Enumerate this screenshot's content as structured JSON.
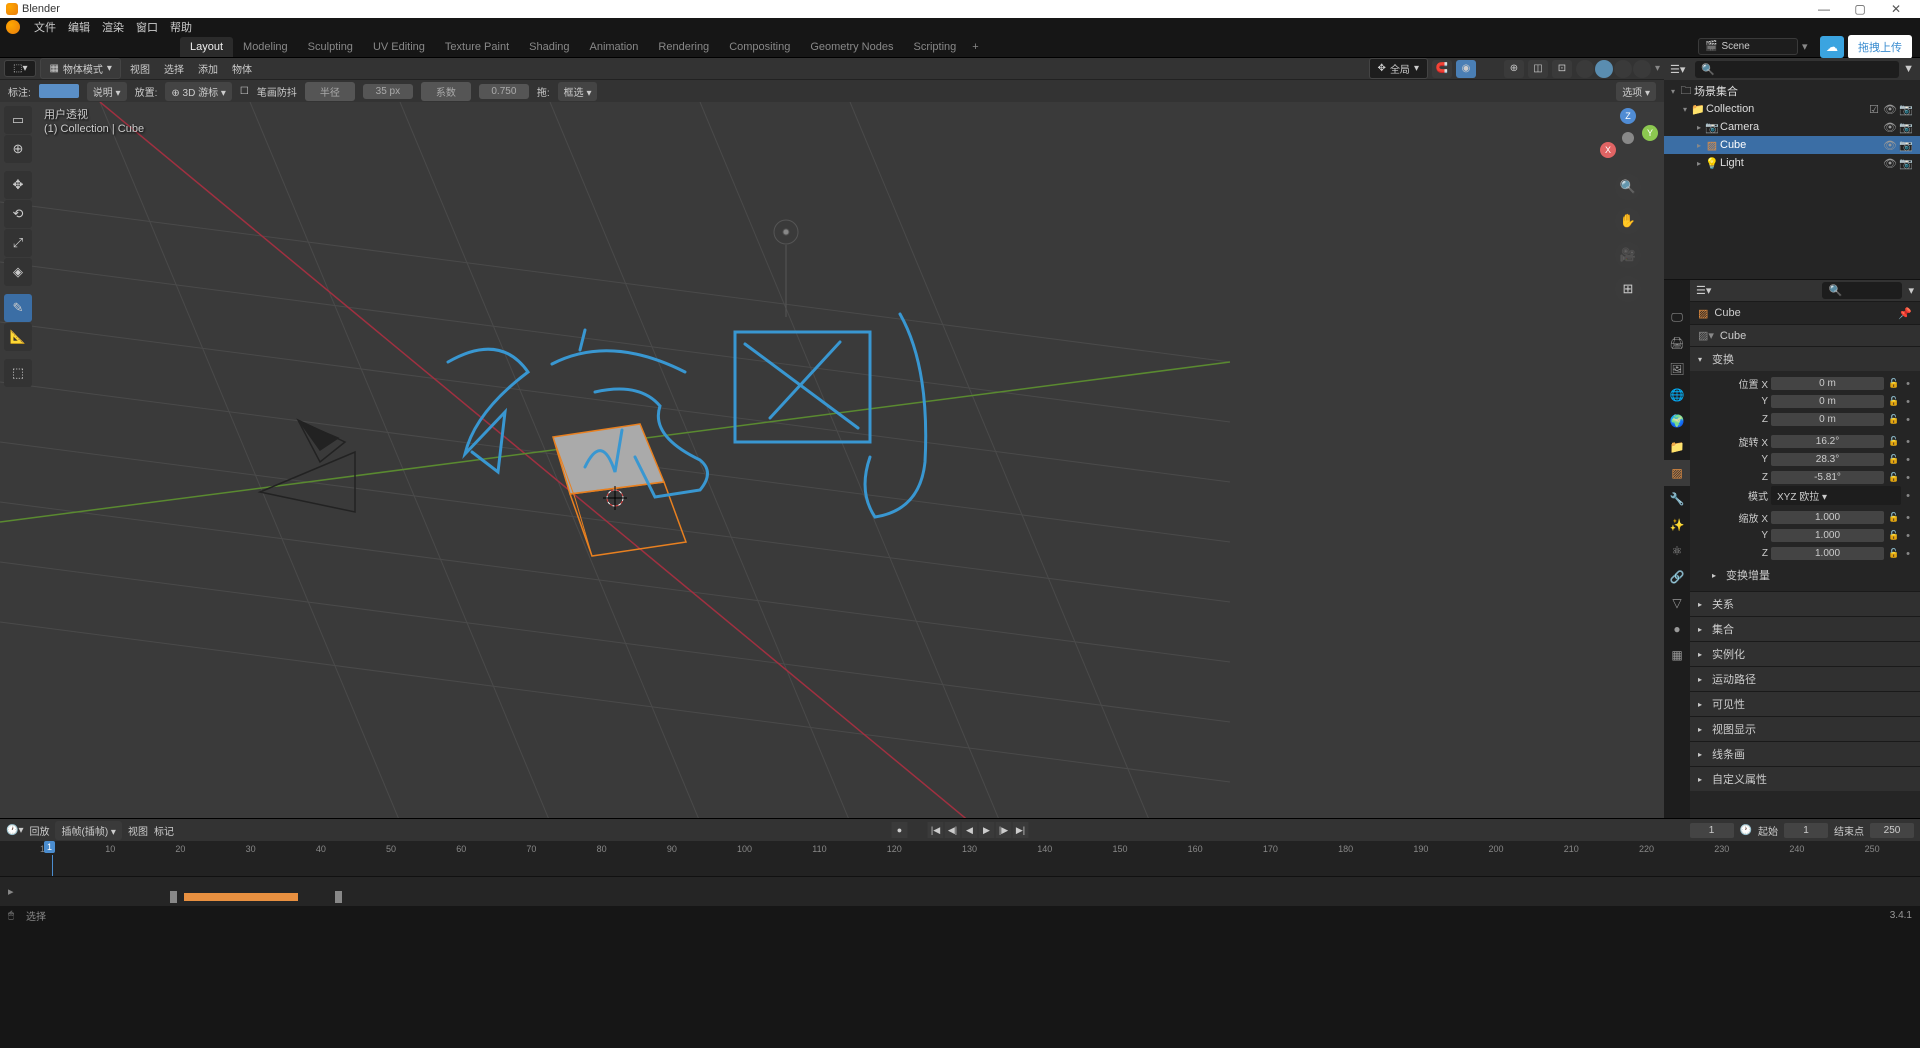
{
  "app_title": "Blender",
  "top_menu": [
    "文件",
    "编辑",
    "渲染",
    "窗口",
    "帮助"
  ],
  "workspaces": {
    "tabs": [
      "Layout",
      "Modeling",
      "Sculpting",
      "UV Editing",
      "Texture Paint",
      "Shading",
      "Animation",
      "Rendering",
      "Compositing",
      "Geometry Nodes",
      "Scripting"
    ],
    "active": 0
  },
  "scene_field": "Scene",
  "upload_button": "拖拽上传",
  "viewport_header": {
    "mode": "物体模式",
    "menus": [
      "视图",
      "选择",
      "添加",
      "物体"
    ],
    "global": "全局",
    "options": "选项"
  },
  "annotate_bar": {
    "label": "标注:",
    "note": "说明",
    "placement": "放置:",
    "cursor3d": "3D 游标",
    "stabilize": "笔画防抖",
    "radius_label": "半径",
    "radius_value": "35 px",
    "coeff_label": "系数",
    "coeff_value": "0.750",
    "drag": "拖:",
    "box_select": "框选"
  },
  "viewport_overlay": {
    "line1": "用户透视",
    "line2": "(1) Collection | Cube"
  },
  "outliner": {
    "root": "场景集合",
    "items": [
      {
        "name": "Collection",
        "icon": "📁",
        "children": [
          {
            "name": "Camera",
            "icon": "📷"
          },
          {
            "name": "Cube",
            "icon": "▨",
            "selected": true
          },
          {
            "name": "Light",
            "icon": "💡"
          }
        ]
      }
    ]
  },
  "properties": {
    "breadcrumb": "Cube",
    "data_name": "Cube",
    "panels": {
      "transform": {
        "title": "变换",
        "location_label": "位置",
        "location": {
          "X": "0 m",
          "Y": "0 m",
          "Z": "0 m"
        },
        "rotation_label": "旋转",
        "rotation": {
          "X": "16.2°",
          "Y": "28.3°",
          "Z": "-5.81°"
        },
        "mode_label": "模式",
        "mode_value": "XYZ 欧拉",
        "scale_label": "缩放",
        "scale": {
          "X": "1.000",
          "Y": "1.000",
          "Z": "1.000"
        },
        "delta_label": "变换增量"
      },
      "collapsed": [
        "关系",
        "集合",
        "实例化",
        "运动路径",
        "可见性",
        "视图显示",
        "线条画",
        "自定义属性"
      ]
    }
  },
  "timeline": {
    "playback": "回放",
    "keying": "插帧(插帧)",
    "menus": [
      "视图",
      "标记"
    ],
    "current_frame": "1",
    "start_label": "起始",
    "start": "1",
    "end_label": "结束点",
    "end": "250",
    "ticks": [
      "1",
      "10",
      "20",
      "30",
      "40",
      "50",
      "60",
      "70",
      "80",
      "90",
      "100",
      "110",
      "120",
      "130",
      "140",
      "150",
      "160",
      "170",
      "180",
      "190",
      "200",
      "210",
      "220",
      "230",
      "240",
      "250"
    ]
  },
  "statusbar": {
    "select": "选择",
    "version": "3.4.1"
  }
}
